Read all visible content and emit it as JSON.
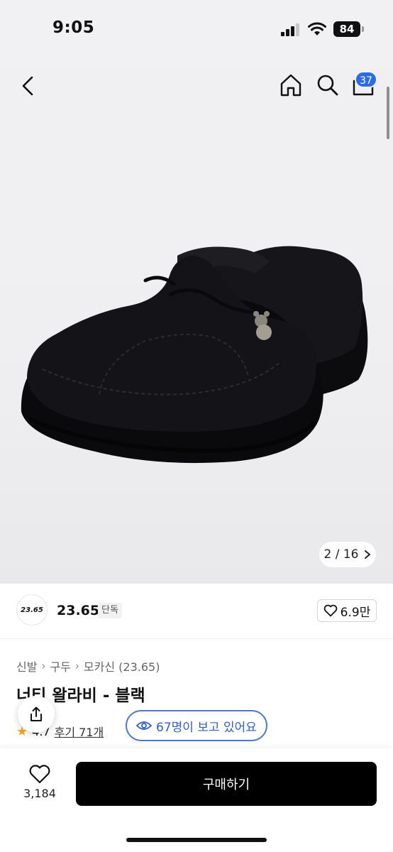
{
  "status": {
    "time": "9:05",
    "battery": "84"
  },
  "nav": {
    "cart_count": "37"
  },
  "gallery": {
    "counter": "2 / 16"
  },
  "seller": {
    "logo_text": "23.65",
    "name": "23.65",
    "badge": "단독",
    "likes": "6.9만"
  },
  "breadcrumb": [
    "신발",
    "구두",
    "모카신 (23.65)"
  ],
  "product": {
    "title": "너티 왈라비 - 블랙",
    "rating": "4.7",
    "reviews": "후기 71개"
  },
  "viewing": {
    "label": "67명이 보고 있어요"
  },
  "bottom": {
    "wish_count": "3,184",
    "buy_label": "구매하기"
  },
  "colors": {
    "accent": "#2c6be8",
    "viewing_border": "#4a76d6",
    "buy_bg": "#000000",
    "star": "#f5a623"
  },
  "icons": [
    "back-icon",
    "home-icon",
    "search-icon",
    "cart-icon",
    "heart-icon",
    "share-icon",
    "eye-icon",
    "star-icon",
    "chevron-right-icon"
  ]
}
